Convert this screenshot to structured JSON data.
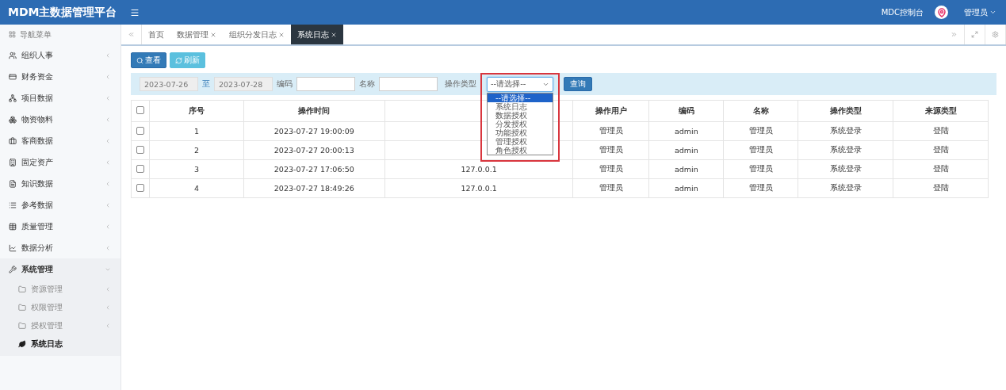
{
  "header": {
    "brand": "MDM主数据管理平台",
    "console_link": "MDC控制台",
    "user": "管理员"
  },
  "sidebar": {
    "title": "导航菜单",
    "items": [
      {
        "label": "组织人事",
        "expanded": false
      },
      {
        "label": "财务资金",
        "expanded": false
      },
      {
        "label": "项目数据",
        "expanded": false
      },
      {
        "label": "物资物料",
        "expanded": false
      },
      {
        "label": "客商数据",
        "expanded": false
      },
      {
        "label": "固定资产",
        "expanded": false
      },
      {
        "label": "知识数据",
        "expanded": false
      },
      {
        "label": "参考数据",
        "expanded": false
      },
      {
        "label": "质量管理",
        "expanded": false
      },
      {
        "label": "数据分析",
        "expanded": false
      },
      {
        "label": "系统管理",
        "expanded": true,
        "children": [
          {
            "label": "资源管理",
            "kind": "folder",
            "selected": false
          },
          {
            "label": "权限管理",
            "kind": "folder",
            "selected": false
          },
          {
            "label": "授权管理",
            "kind": "folder",
            "selected": false
          },
          {
            "label": "系统日志",
            "kind": "page",
            "selected": true
          }
        ]
      }
    ]
  },
  "tabs": [
    {
      "label": "首页",
      "closable": false,
      "selected": false
    },
    {
      "label": "数据管理",
      "closable": true,
      "selected": false
    },
    {
      "label": "组织分发日志",
      "closable": true,
      "selected": false
    },
    {
      "label": "系统日志",
      "closable": true,
      "selected": true
    }
  ],
  "toolbar": [
    {
      "label": "查看",
      "kind": "primary"
    },
    {
      "label": "刷新",
      "kind": "info"
    }
  ],
  "filters": {
    "date_from": "2023-07-26",
    "date_sep": "至",
    "date_to": "2023-07-28",
    "code_label": "编码",
    "name_label": "名称",
    "type_label": "操作类型",
    "type_select": {
      "value": "--请选择--",
      "open": true,
      "options": [
        {
          "label": "--请选择--",
          "selected": true
        },
        {
          "label": "系统日志",
          "selected": false
        },
        {
          "label": "数据授权",
          "selected": false
        },
        {
          "label": "分发授权",
          "selected": false
        },
        {
          "label": "功能授权",
          "selected": false
        },
        {
          "label": "管理授权",
          "selected": false
        },
        {
          "label": "角色授权",
          "selected": false
        }
      ]
    },
    "query_button": "查询"
  },
  "table": {
    "select_all": false,
    "columns": [
      "序号",
      "操作时间",
      null,
      "操作用户",
      "编码",
      "名称",
      "操作类型",
      "来源类型"
    ],
    "rows": [
      {
        "checked": false,
        "cells": [
          "1",
          "2023-07-27 19:00:09",
          null,
          "管理员",
          "admin",
          "管理员",
          "系统登录",
          "登陆"
        ]
      },
      {
        "checked": false,
        "cells": [
          "2",
          "2023-07-27 20:00:13",
          null,
          "管理员",
          "admin",
          "管理员",
          "系统登录",
          "登陆"
        ]
      },
      {
        "checked": false,
        "cells": [
          "3",
          "2023-07-27 17:06:50",
          "127.0.0.1",
          "管理员",
          "admin",
          "管理员",
          "系统登录",
          "登陆"
        ]
      },
      {
        "checked": false,
        "cells": [
          "4",
          "2023-07-27 18:49:26",
          "127.0.0.1",
          "管理员",
          "admin",
          "管理员",
          "系统登录",
          "登陆"
        ]
      }
    ]
  }
}
